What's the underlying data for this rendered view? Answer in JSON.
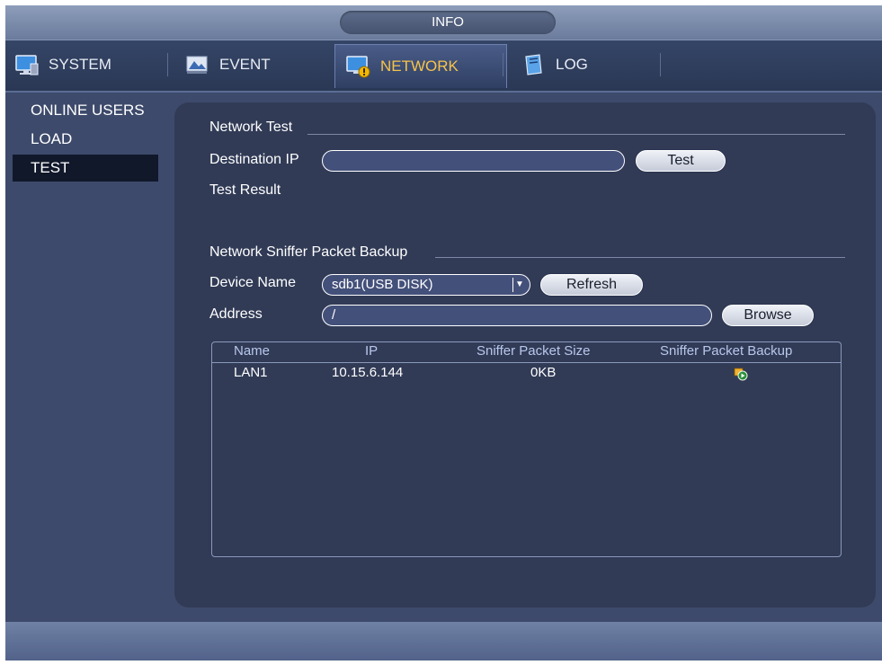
{
  "window": {
    "title": "INFO"
  },
  "tabs": [
    {
      "label": "SYSTEM",
      "icon": "monitor-icon",
      "active": false
    },
    {
      "label": "EVENT",
      "icon": "event-icon",
      "active": false
    },
    {
      "label": "NETWORK",
      "icon": "network-icon",
      "active": true
    },
    {
      "label": "LOG",
      "icon": "log-book-icon",
      "active": false
    }
  ],
  "sidebar": {
    "items": [
      {
        "label": "ONLINE USERS",
        "active": false
      },
      {
        "label": "LOAD",
        "active": false
      },
      {
        "label": "TEST",
        "active": true
      }
    ]
  },
  "network_test": {
    "section_title": "Network Test",
    "destination_ip_label": "Destination IP",
    "destination_ip_value": "",
    "test_button": "Test",
    "test_result_label": "Test Result"
  },
  "sniffer": {
    "section_title": "Network Sniffer Packet Backup",
    "device_name_label": "Device Name",
    "device_name_value": "sdb1(USB DISK)",
    "refresh_button": "Refresh",
    "address_label": "Address",
    "address_value": "/",
    "browse_button": "Browse",
    "table": {
      "columns": [
        "Name",
        "IP",
        "Sniffer Packet Size",
        "Sniffer Packet Backup"
      ],
      "rows": [
        {
          "name": "LAN1",
          "ip": "10.15.6.144",
          "size": "0KB",
          "backup_icon": "play-backup-icon"
        }
      ]
    }
  },
  "colors": {
    "background": "#3d4a6b",
    "panel": "#313b56",
    "active_tab_text": "#f6c34a",
    "sidebar_active": "#11182a",
    "header_text": "#b9c7ec"
  }
}
